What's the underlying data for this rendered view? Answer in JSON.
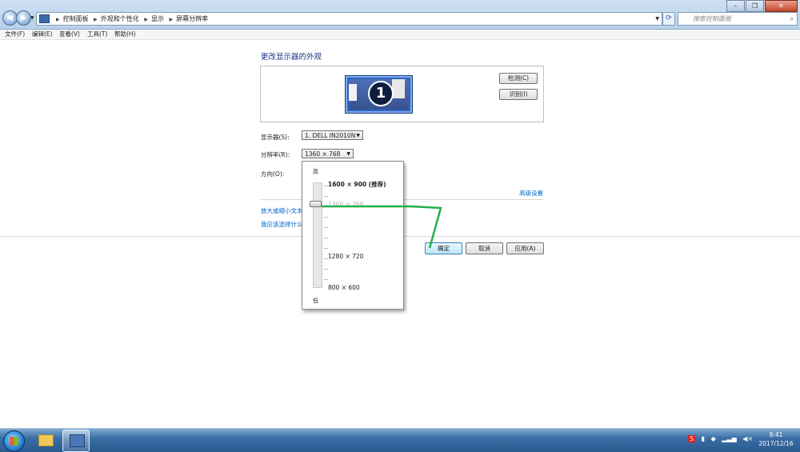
{
  "breadcrumbs": [
    "控制面板",
    "外观和个性化",
    "显示",
    "屏幕分辨率"
  ],
  "search": {
    "placeholder": "搜索控制面板"
  },
  "menu": [
    "文件(F)",
    "编辑(E)",
    "查看(V)",
    "工具(T)",
    "帮助(H)"
  ],
  "page": {
    "title": "更改显示器的外观",
    "monitor_number": "1",
    "detect_button": "检测(C)",
    "identify_button": "识别(I)",
    "display_label": "显示器(S):",
    "display_value": "1. DELL IN2010N",
    "resolution_label": "分辨率(R):",
    "resolution_value": "1360 × 768",
    "orientation_label": "方向(O):",
    "advanced_link": "高级设置",
    "link1": "放大或缩小文本",
    "link2": "我应该选择什么",
    "ok_button": "确定",
    "cancel_button": "取消",
    "apply_button": "应用(A)"
  },
  "resolution_dropdown": {
    "high_label": "高",
    "low_label": "低",
    "options": {
      "recommended": "1600 × 900 (推荐)",
      "current": "1360 × 768",
      "mid": "1280 × 720",
      "low": "800 × 600"
    }
  },
  "taskbar": {
    "clock_time": "8:41",
    "clock_date": "2017/12/16",
    "tray_badge": "S"
  },
  "colors": {
    "accent": "#1e3287",
    "link": "#0066cc",
    "annotation": "#22b04a"
  }
}
